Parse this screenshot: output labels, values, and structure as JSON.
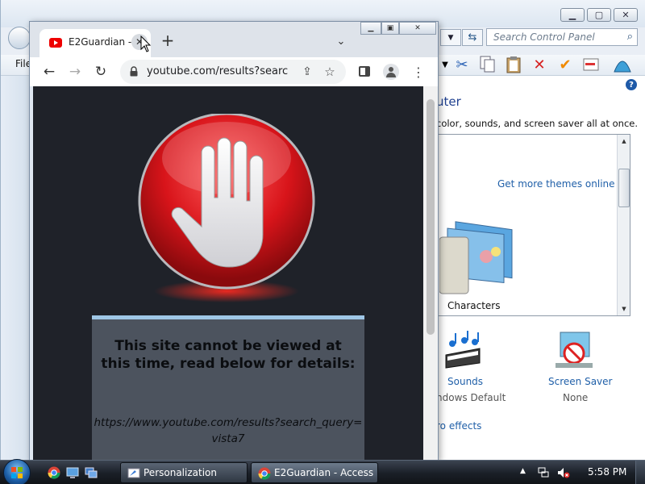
{
  "control_panel": {
    "search_placeholder": "Search Control Panel",
    "menu_file": "File",
    "heading": "uter",
    "subtext": "color, sounds, and screen saver all at once.",
    "more_themes_link": "Get more themes online",
    "theme_name": "Characters",
    "sounds_label": "Sounds",
    "sounds_value": "ndows Default",
    "screensaver_label": "Screen Saver",
    "screensaver_value": "None",
    "effects_link": "ro effects",
    "help_label": "?"
  },
  "chrome": {
    "tab_title": "E2Guardian -",
    "url": "youtube.com/results?searc...",
    "blocked_heading": "This site cannot be viewed at this time, read below for details:",
    "blocked_url": "https://www.youtube.com/results?search_query=vista7"
  },
  "taskbar": {
    "tasks": [
      {
        "label": "Personalization"
      },
      {
        "label": "E2Guardian - Access ..."
      }
    ],
    "clock": "5:58 PM"
  },
  "colors": {
    "link": "#1f5fa8",
    "stop_red": "#d8141a",
    "page_background": "#1f2229",
    "block_panel": "#4c535e"
  }
}
